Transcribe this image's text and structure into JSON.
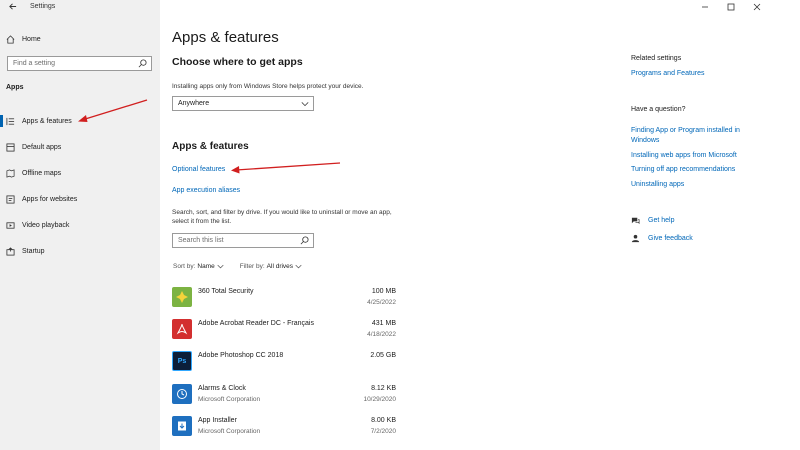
{
  "window": {
    "title": "Settings",
    "back_icon": "back-arrow-icon",
    "controls": [
      "minimize-icon",
      "maximize-icon",
      "close-icon"
    ]
  },
  "sidebar": {
    "home_label": "Home",
    "search_placeholder": "Find a setting",
    "section_label": "Apps",
    "items": [
      {
        "label": "Apps & features",
        "icon": "apps-list-icon",
        "active": true
      },
      {
        "label": "Default apps",
        "icon": "default-apps-icon"
      },
      {
        "label": "Offline maps",
        "icon": "map-icon"
      },
      {
        "label": "Apps for websites",
        "icon": "website-icon"
      },
      {
        "label": "Video playback",
        "icon": "video-icon"
      },
      {
        "label": "Startup",
        "icon": "startup-icon"
      }
    ]
  },
  "main": {
    "title": "Apps & features",
    "choose_title": "Choose where to get apps",
    "choose_help": "Installing apps only from Windows Store helps protect your device.",
    "source_select": "Anywhere",
    "section_title": "Apps & features",
    "optional_features_link": "Optional features",
    "execution_aliases_link": "App execution aliases",
    "search_desc": "Search, sort, and filter by drive. If you would like to uninstall or move an app, select it from the list.",
    "search_list_placeholder": "Search this list",
    "sort_label": "Sort by:",
    "sort_value": "Name",
    "filter_label": "Filter by:",
    "filter_value": "All drives",
    "apps": [
      {
        "name": "360 Total Security",
        "publisher": "",
        "size": "100 MB",
        "date": "4/25/2022",
        "icon": "360-security-icon",
        "color": "#7cb342"
      },
      {
        "name": "Adobe Acrobat Reader DC - Français",
        "publisher": "",
        "size": "431 MB",
        "date": "4/18/2022",
        "icon": "acrobat-icon",
        "color": "#d32f2f"
      },
      {
        "name": "Adobe Photoshop CC 2018",
        "publisher": "",
        "size": "2.05 GB",
        "date": "",
        "icon": "photoshop-icon",
        "color": "#0b1e3a"
      },
      {
        "name": "Alarms & Clock",
        "publisher": "Microsoft Corporation",
        "size": "8.12 KB",
        "date": "10/29/2020",
        "icon": "alarm-clock-icon",
        "color": "#1e6fbf"
      },
      {
        "name": "App Installer",
        "publisher": "Microsoft Corporation",
        "size": "8.00 KB",
        "date": "7/2/2020",
        "icon": "app-installer-icon",
        "color": "#1e6fbf"
      }
    ]
  },
  "related": {
    "related_heading": "Related settings",
    "related_links": [
      "Programs and Features"
    ],
    "question_heading": "Have a question?",
    "question_links": [
      "Finding App or Program installed in Windows",
      "Installing web apps from Microsoft",
      "Turning off app recommendations",
      "Uninstalling apps"
    ],
    "get_help": "Get help",
    "give_feedback": "Give feedback"
  },
  "colors": {
    "accent": "#0067b8",
    "annotation_arrow": "#d11f1f",
    "sidebar_bg": "#f0f0f0"
  }
}
